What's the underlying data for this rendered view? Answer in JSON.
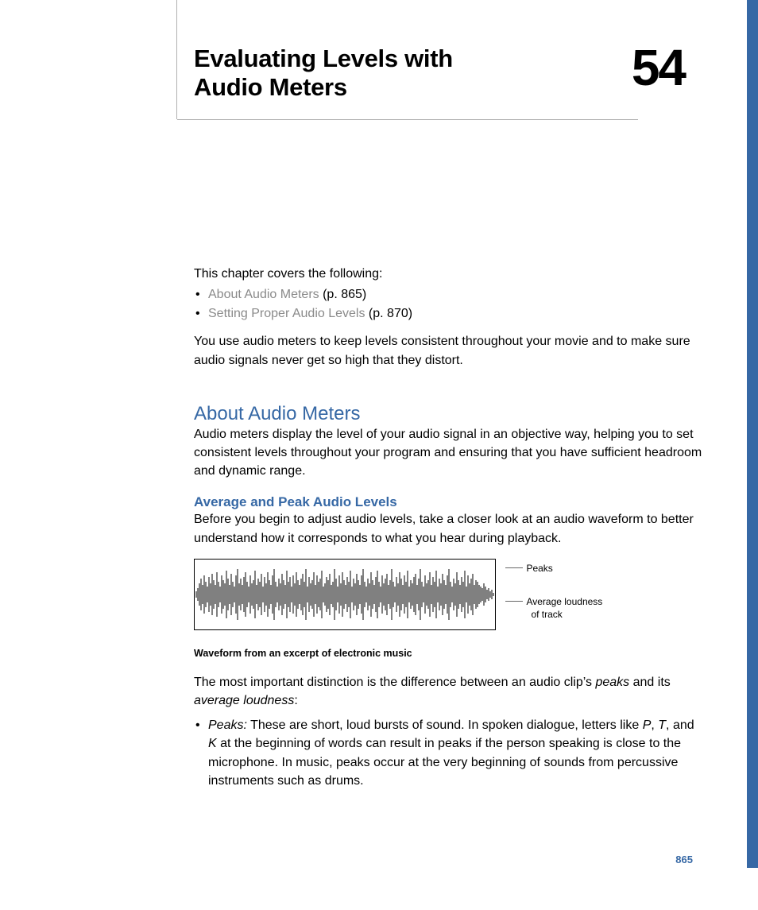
{
  "chapter": {
    "title": "Evaluating Levels with Audio Meters",
    "number": "54"
  },
  "intro": {
    "lead": "This chapter covers the following:",
    "toc": [
      {
        "link": "About Audio Meters",
        "page": "(p. 865)"
      },
      {
        "link": "Setting Proper Audio Levels",
        "page": "(p. 870)"
      }
    ],
    "para": "You use audio meters to keep levels consistent throughout your movie and to make sure audio signals never get so high that they distort."
  },
  "section1": {
    "heading": "About Audio Meters",
    "para": "Audio meters display the level of your audio signal in an objective way, helping you to set consistent levels throughout your program and ensuring that you have sufficient headroom and dynamic range."
  },
  "section2": {
    "heading": "Average and Peak Audio Levels",
    "para": "Before you begin to adjust audio levels, take a closer look at an audio waveform to better understand how it corresponds to what you hear during playback."
  },
  "figure": {
    "label_peaks": "Peaks",
    "label_avg1": "Average loudness",
    "label_avg2": "of track",
    "caption": "Waveform from an excerpt of electronic music"
  },
  "para_distinction_1": "The most important distinction is the difference between an audio clip’s ",
  "para_distinction_peaks": "peaks",
  "para_distinction_2": " and its ",
  "para_distinction_avg": "average loudness",
  "para_distinction_3": ":",
  "bullet_peaks": {
    "term": "Peaks:",
    "text_1": "  These are short, loud bursts of sound. In spoken dialogue, letters like ",
    "p": "P",
    "c1": ", ",
    "t": "T",
    "c2": ", and ",
    "k": "K",
    "text_2": " at the beginning of words can result in peaks if the person speaking is close to the microphone. In music, peaks occur at the very beginning of sounds from percussive instruments such as drums."
  },
  "page_number": "865"
}
